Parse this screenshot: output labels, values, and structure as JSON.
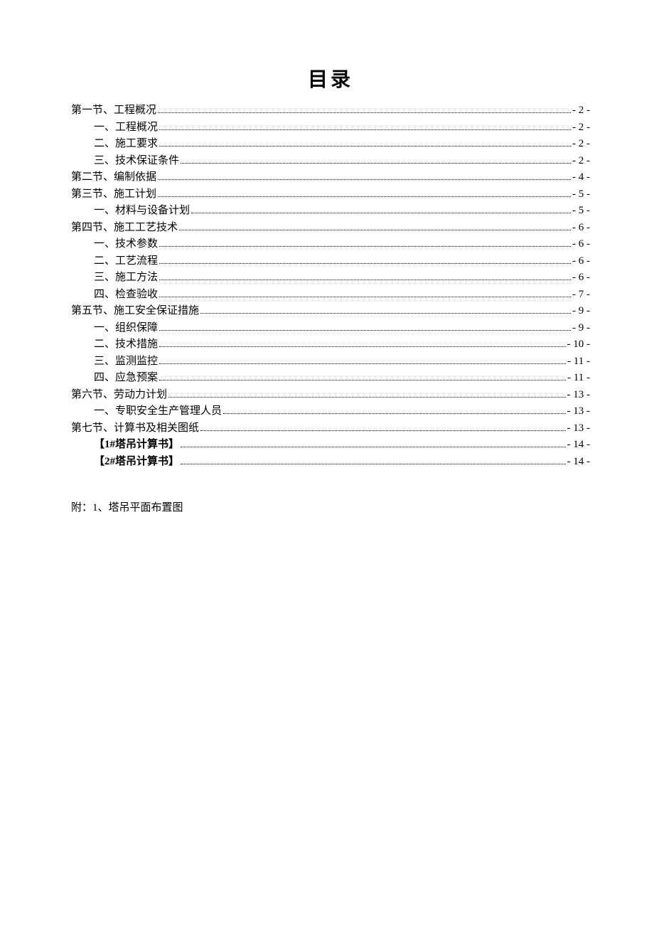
{
  "title": "目录",
  "entries": [
    {
      "level": 0,
      "label": "第一节、工程概况",
      "page": "- 2 -",
      "bold": false
    },
    {
      "level": 1,
      "label": "一、工程概况",
      "page": "- 2 -",
      "bold": false
    },
    {
      "level": 1,
      "label": "二、施工要求",
      "page": "- 2 -",
      "bold": false
    },
    {
      "level": 1,
      "label": "三、技术保证条件",
      "page": "- 2 -",
      "bold": false
    },
    {
      "level": 0,
      "label": "第二节、编制依据",
      "page": "- 4 -",
      "bold": false
    },
    {
      "level": 0,
      "label": "第三节、施工计划",
      "page": "- 5 -",
      "bold": false
    },
    {
      "level": 1,
      "label": "一、材料与设备计划",
      "page": "- 5 -",
      "bold": false
    },
    {
      "level": 0,
      "label": "第四节、施工工艺技术",
      "page": "- 6 -",
      "bold": false
    },
    {
      "level": 1,
      "label": "一、技术参数",
      "page": "- 6 -",
      "bold": false
    },
    {
      "level": 1,
      "label": "二、工艺流程",
      "page": "- 6 -",
      "bold": false
    },
    {
      "level": 1,
      "label": "三、施工方法",
      "page": "- 6 -",
      "bold": false
    },
    {
      "level": 1,
      "label": "四、检查验收",
      "page": "- 7 -",
      "bold": false
    },
    {
      "level": 0,
      "label": "第五节、施工安全保证措施",
      "page": "- 9 -",
      "bold": false
    },
    {
      "level": 1,
      "label": "一、组织保障",
      "page": "- 9 -",
      "bold": false
    },
    {
      "level": 1,
      "label": "二、技术措施",
      "page": "- 10 -",
      "bold": false
    },
    {
      "level": 1,
      "label": "三、监测监控",
      "page": "- 11 -",
      "bold": false
    },
    {
      "level": 1,
      "label": "四、应急预案",
      "page": "- 11 -",
      "bold": false
    },
    {
      "level": 0,
      "label": "第六节、劳动力计划",
      "page": "- 13 -",
      "bold": false
    },
    {
      "level": 1,
      "label": "一、专职安全生产管理人员",
      "page": "- 13 -",
      "bold": false
    },
    {
      "level": 0,
      "label": "第七节、计算书及相关图纸",
      "page": "- 13 -",
      "bold": false
    },
    {
      "level": 1,
      "label": "【1#塔吊计算书】",
      "page": "- 14 -",
      "bold": true
    },
    {
      "level": 1,
      "label": "【2#塔吊计算书】",
      "page": "- 14 -",
      "bold": true
    }
  ],
  "appendix": "附：1、塔吊平面布置图"
}
